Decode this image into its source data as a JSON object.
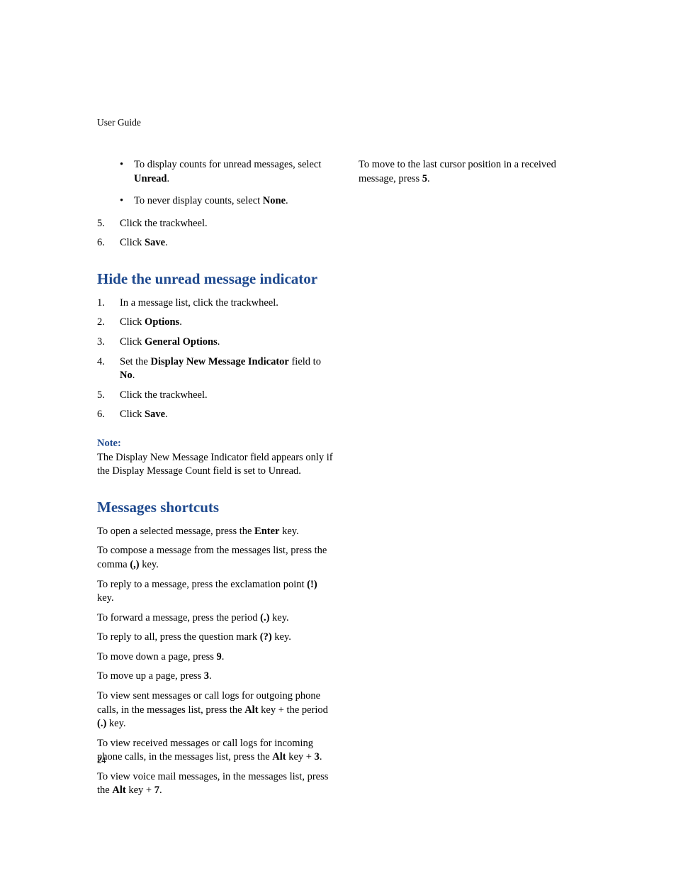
{
  "header": "User Guide",
  "pageNumber": "24",
  "col1": {
    "bullets": [
      {
        "pre": "To display counts for unread messages, select ",
        "bold": "Unread",
        "post": "."
      },
      {
        "pre": "To never display counts, select ",
        "bold": "None",
        "post": "."
      }
    ],
    "topSteps": [
      {
        "pre": "Click the trackwheel."
      },
      {
        "pre": "Click ",
        "bold": "Save",
        "post": "."
      }
    ],
    "section1": {
      "heading": "Hide the unread message indicator",
      "steps": [
        {
          "pre": "In a message list, click the trackwheel."
        },
        {
          "pre": "Click ",
          "bold": "Options",
          "post": "."
        },
        {
          "pre": "Click ",
          "bold": "General Options",
          "post": "."
        },
        {
          "pre": "Set the ",
          "bold": "Display New Message Indicator",
          "post": " field to ",
          "bold2": "No",
          "post2": "."
        },
        {
          "pre": "Click the trackwheel."
        },
        {
          "pre": "Click ",
          "bold": "Save",
          "post": "."
        }
      ],
      "note": {
        "label": "Note:",
        "body": "The Display New Message Indicator field appears only if the Display Message Count field is set to Unread."
      }
    },
    "section2": {
      "heading": "Messages shortcuts",
      "paras": [
        {
          "pre": "To open a selected message, press the ",
          "bold": "Enter",
          "post": " key."
        },
        {
          "pre": "To compose a message from the messages list, press the comma ",
          "bold": "(,)",
          "post": " key."
        },
        {
          "pre": "To reply to a message, press the exclamation point ",
          "bold": "(!)",
          "post": " key."
        },
        {
          "pre": "To forward a message, press the period ",
          "bold": "(.)",
          "post": " key."
        },
        {
          "pre": "To reply to all, press the question mark ",
          "bold": "(?)",
          "post": " key."
        },
        {
          "pre": "To move down a page, press ",
          "bold": "9",
          "post": "."
        },
        {
          "pre": "To move up a page, press ",
          "bold": "3",
          "post": "."
        },
        {
          "pre": "To view sent messages or call logs for outgoing phone calls, in the messages list, press the ",
          "bold": "Alt",
          "post": " key + the period ",
          "bold2": "(.)",
          "post2": " key."
        },
        {
          "pre": "To view received messages or call logs for incoming phone calls, in the messages list, press the ",
          "bold": "Alt",
          "post": " key + ",
          "bold2": "3",
          "post2": "."
        },
        {
          "pre": "To view voice mail messages, in the messages list, press the ",
          "bold": "Alt",
          "post": " key + ",
          "bold2": "7",
          "post2": "."
        }
      ]
    }
  },
  "col2": {
    "paras": [
      {
        "pre": "To move to the last cursor position in a received message, press ",
        "bold": "5",
        "post": "."
      }
    ]
  }
}
